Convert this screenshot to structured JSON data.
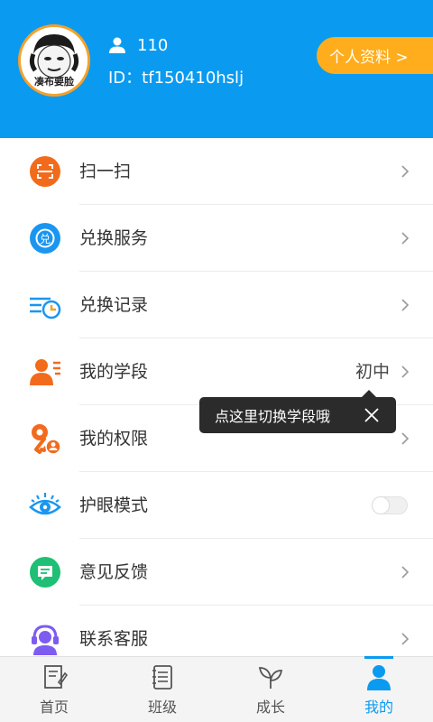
{
  "profile": {
    "avatar_caption": "凑布要脸",
    "user_count": "110",
    "id_text": "ID：tf150410hslj",
    "profile_button": "个人资料 >"
  },
  "menu": {
    "items": [
      {
        "label": "扫一扫",
        "icon": "scan-icon",
        "color": "#f26b1d"
      },
      {
        "label": "兑换服务",
        "icon": "exchange-service-icon",
        "color": "#1a96f0"
      },
      {
        "label": "兑换记录",
        "icon": "exchange-record-icon",
        "color": "#1a96f0"
      },
      {
        "label": "我的学段",
        "icon": "grade-level-icon",
        "color": "#f26b1d",
        "value": "初中"
      },
      {
        "label": "我的权限",
        "icon": "permission-key-icon",
        "color": "#f26b1d"
      },
      {
        "label": "护眼模式",
        "icon": "eye-icon",
        "color": "#1a96f0",
        "toggle_on": false
      },
      {
        "label": "意见反馈",
        "icon": "feedback-icon",
        "color": "#1fbf75"
      },
      {
        "label": "联系客服",
        "icon": "customer-service-icon",
        "color": "#7d5cf0"
      }
    ]
  },
  "tooltip": {
    "text": "点这里切换学段哦"
  },
  "tabbar": {
    "tabs": [
      {
        "label": "首页",
        "icon": "home-notebook-icon",
        "active": false
      },
      {
        "label": "班级",
        "icon": "class-book-icon",
        "active": false
      },
      {
        "label": "成长",
        "icon": "sprout-icon",
        "active": false
      },
      {
        "label": "我的",
        "icon": "me-person-icon",
        "active": true
      }
    ]
  },
  "colors": {
    "header": "#0a9bf0",
    "profile_button": "#ffad1d",
    "active_tab": "#0a9bf0"
  }
}
